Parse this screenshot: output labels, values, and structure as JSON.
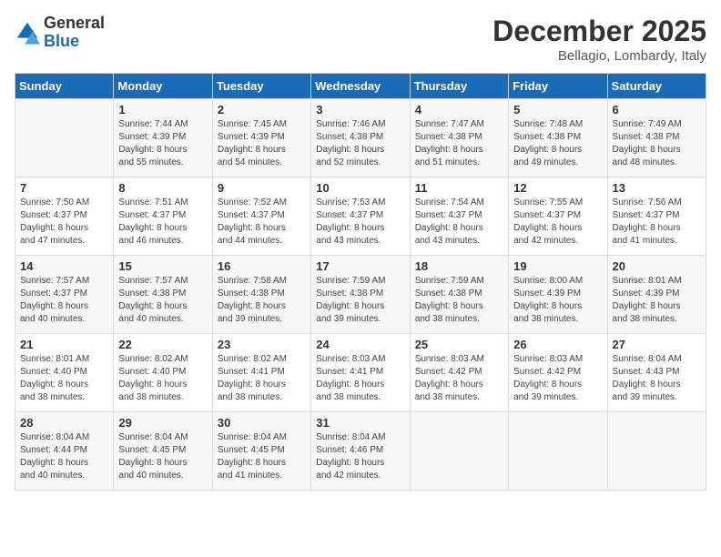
{
  "logo": {
    "general": "General",
    "blue": "Blue"
  },
  "title": "December 2025",
  "location": "Bellagio, Lombardy, Italy",
  "days_of_week": [
    "Sunday",
    "Monday",
    "Tuesday",
    "Wednesday",
    "Thursday",
    "Friday",
    "Saturday"
  ],
  "weeks": [
    [
      {
        "day": "",
        "sunrise": "",
        "sunset": "",
        "daylight": ""
      },
      {
        "day": "1",
        "sunrise": "Sunrise: 7:44 AM",
        "sunset": "Sunset: 4:39 PM",
        "daylight": "Daylight: 8 hours and 55 minutes."
      },
      {
        "day": "2",
        "sunrise": "Sunrise: 7:45 AM",
        "sunset": "Sunset: 4:39 PM",
        "daylight": "Daylight: 8 hours and 54 minutes."
      },
      {
        "day": "3",
        "sunrise": "Sunrise: 7:46 AM",
        "sunset": "Sunset: 4:38 PM",
        "daylight": "Daylight: 8 hours and 52 minutes."
      },
      {
        "day": "4",
        "sunrise": "Sunrise: 7:47 AM",
        "sunset": "Sunset: 4:38 PM",
        "daylight": "Daylight: 8 hours and 51 minutes."
      },
      {
        "day": "5",
        "sunrise": "Sunrise: 7:48 AM",
        "sunset": "Sunset: 4:38 PM",
        "daylight": "Daylight: 8 hours and 49 minutes."
      },
      {
        "day": "6",
        "sunrise": "Sunrise: 7:49 AM",
        "sunset": "Sunset: 4:38 PM",
        "daylight": "Daylight: 8 hours and 48 minutes."
      }
    ],
    [
      {
        "day": "7",
        "sunrise": "Sunrise: 7:50 AM",
        "sunset": "Sunset: 4:37 PM",
        "daylight": "Daylight: 8 hours and 47 minutes."
      },
      {
        "day": "8",
        "sunrise": "Sunrise: 7:51 AM",
        "sunset": "Sunset: 4:37 PM",
        "daylight": "Daylight: 8 hours and 46 minutes."
      },
      {
        "day": "9",
        "sunrise": "Sunrise: 7:52 AM",
        "sunset": "Sunset: 4:37 PM",
        "daylight": "Daylight: 8 hours and 44 minutes."
      },
      {
        "day": "10",
        "sunrise": "Sunrise: 7:53 AM",
        "sunset": "Sunset: 4:37 PM",
        "daylight": "Daylight: 8 hours and 43 minutes."
      },
      {
        "day": "11",
        "sunrise": "Sunrise: 7:54 AM",
        "sunset": "Sunset: 4:37 PM",
        "daylight": "Daylight: 8 hours and 43 minutes."
      },
      {
        "day": "12",
        "sunrise": "Sunrise: 7:55 AM",
        "sunset": "Sunset: 4:37 PM",
        "daylight": "Daylight: 8 hours and 42 minutes."
      },
      {
        "day": "13",
        "sunrise": "Sunrise: 7:56 AM",
        "sunset": "Sunset: 4:37 PM",
        "daylight": "Daylight: 8 hours and 41 minutes."
      }
    ],
    [
      {
        "day": "14",
        "sunrise": "Sunrise: 7:57 AM",
        "sunset": "Sunset: 4:37 PM",
        "daylight": "Daylight: 8 hours and 40 minutes."
      },
      {
        "day": "15",
        "sunrise": "Sunrise: 7:57 AM",
        "sunset": "Sunset: 4:38 PM",
        "daylight": "Daylight: 8 hours and 40 minutes."
      },
      {
        "day": "16",
        "sunrise": "Sunrise: 7:58 AM",
        "sunset": "Sunset: 4:38 PM",
        "daylight": "Daylight: 8 hours and 39 minutes."
      },
      {
        "day": "17",
        "sunrise": "Sunrise: 7:59 AM",
        "sunset": "Sunset: 4:38 PM",
        "daylight": "Daylight: 8 hours and 39 minutes."
      },
      {
        "day": "18",
        "sunrise": "Sunrise: 7:59 AM",
        "sunset": "Sunset: 4:38 PM",
        "daylight": "Daylight: 8 hours and 38 minutes."
      },
      {
        "day": "19",
        "sunrise": "Sunrise: 8:00 AM",
        "sunset": "Sunset: 4:39 PM",
        "daylight": "Daylight: 8 hours and 38 minutes."
      },
      {
        "day": "20",
        "sunrise": "Sunrise: 8:01 AM",
        "sunset": "Sunset: 4:39 PM",
        "daylight": "Daylight: 8 hours and 38 minutes."
      }
    ],
    [
      {
        "day": "21",
        "sunrise": "Sunrise: 8:01 AM",
        "sunset": "Sunset: 4:40 PM",
        "daylight": "Daylight: 8 hours and 38 minutes."
      },
      {
        "day": "22",
        "sunrise": "Sunrise: 8:02 AM",
        "sunset": "Sunset: 4:40 PM",
        "daylight": "Daylight: 8 hours and 38 minutes."
      },
      {
        "day": "23",
        "sunrise": "Sunrise: 8:02 AM",
        "sunset": "Sunset: 4:41 PM",
        "daylight": "Daylight: 8 hours and 38 minutes."
      },
      {
        "day": "24",
        "sunrise": "Sunrise: 8:03 AM",
        "sunset": "Sunset: 4:41 PM",
        "daylight": "Daylight: 8 hours and 38 minutes."
      },
      {
        "day": "25",
        "sunrise": "Sunrise: 8:03 AM",
        "sunset": "Sunset: 4:42 PM",
        "daylight": "Daylight: 8 hours and 38 minutes."
      },
      {
        "day": "26",
        "sunrise": "Sunrise: 8:03 AM",
        "sunset": "Sunset: 4:42 PM",
        "daylight": "Daylight: 8 hours and 39 minutes."
      },
      {
        "day": "27",
        "sunrise": "Sunrise: 8:04 AM",
        "sunset": "Sunset: 4:43 PM",
        "daylight": "Daylight: 8 hours and 39 minutes."
      }
    ],
    [
      {
        "day": "28",
        "sunrise": "Sunrise: 8:04 AM",
        "sunset": "Sunset: 4:44 PM",
        "daylight": "Daylight: 8 hours and 40 minutes."
      },
      {
        "day": "29",
        "sunrise": "Sunrise: 8:04 AM",
        "sunset": "Sunset: 4:45 PM",
        "daylight": "Daylight: 8 hours and 40 minutes."
      },
      {
        "day": "30",
        "sunrise": "Sunrise: 8:04 AM",
        "sunset": "Sunset: 4:45 PM",
        "daylight": "Daylight: 8 hours and 41 minutes."
      },
      {
        "day": "31",
        "sunrise": "Sunrise: 8:04 AM",
        "sunset": "Sunset: 4:46 PM",
        "daylight": "Daylight: 8 hours and 42 minutes."
      },
      {
        "day": "",
        "sunrise": "",
        "sunset": "",
        "daylight": ""
      },
      {
        "day": "",
        "sunrise": "",
        "sunset": "",
        "daylight": ""
      },
      {
        "day": "",
        "sunrise": "",
        "sunset": "",
        "daylight": ""
      }
    ]
  ]
}
